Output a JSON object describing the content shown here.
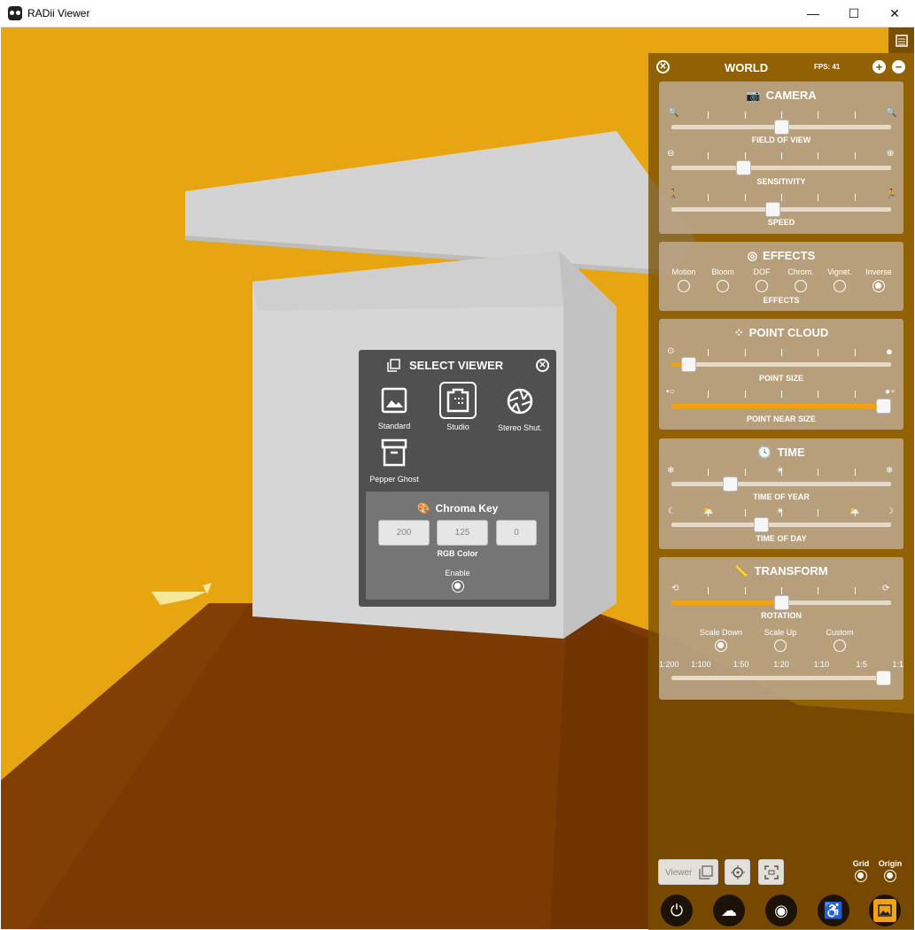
{
  "window": {
    "title": "RADii Viewer",
    "minimize": "—",
    "maximize": "☐",
    "close": "✕"
  },
  "world": {
    "title": "WORLD",
    "fps": "FPS: 41",
    "camera": {
      "title": "CAMERA",
      "field_of_view": {
        "label": "FIELD OF VIEW",
        "value": 0.5
      },
      "sensitivity": {
        "label": "SENSITIVITY",
        "value": 0.33
      },
      "speed": {
        "label": "SPEED",
        "value": 0.46
      }
    },
    "effects": {
      "title": "EFFECTS",
      "caption": "EFFECTS",
      "options": [
        {
          "label": "Motion",
          "on": false
        },
        {
          "label": "Bloom",
          "on": false
        },
        {
          "label": "DOF",
          "on": false
        },
        {
          "label": "Chrom.",
          "on": false
        },
        {
          "label": "Vignet.",
          "on": false
        },
        {
          "label": "Inverse",
          "on": true
        }
      ]
    },
    "point_cloud": {
      "title": "POINT CLOUD",
      "point_size": {
        "label": "POINT SIZE",
        "value": 0.08
      },
      "point_near_size": {
        "label": "POINT NEAR SIZE",
        "value": 1.0
      }
    },
    "time": {
      "title": "TIME",
      "time_of_year": {
        "label": "TIME OF YEAR",
        "value": 0.27
      },
      "time_of_day": {
        "label": "TIME OF DAY",
        "value": 0.41
      }
    },
    "transform": {
      "title": "TRANSFORM",
      "rotation": {
        "label": "ROTATION",
        "value": 0.5
      },
      "modes": [
        {
          "label": "Scale Down",
          "on": true
        },
        {
          "label": "Scale Up",
          "on": false
        },
        {
          "label": "Custom",
          "on": false
        }
      ],
      "scales": [
        "1:200",
        "1:100",
        "1:50",
        "1:20",
        "1:10",
        "1:5",
        "1:1"
      ],
      "scale_value": 1.0
    },
    "footer": {
      "viewer_label": "Viewer",
      "grid_label": "Grid",
      "origin_label": "Origin"
    }
  },
  "select_viewer": {
    "title": "SELECT VIEWER",
    "options": [
      {
        "label": "Standard",
        "selected": false
      },
      {
        "label": "Studio",
        "selected": true
      },
      {
        "label": "Stereo Shut.",
        "selected": false
      },
      {
        "label": "Pepper Ghost",
        "selected": false
      }
    ],
    "chroma_key": {
      "title": "Chroma Key",
      "r": "200",
      "g": "125",
      "b": "0",
      "rgb_label": "RGB Color",
      "enable_label": "Enable",
      "enabled": true
    }
  }
}
